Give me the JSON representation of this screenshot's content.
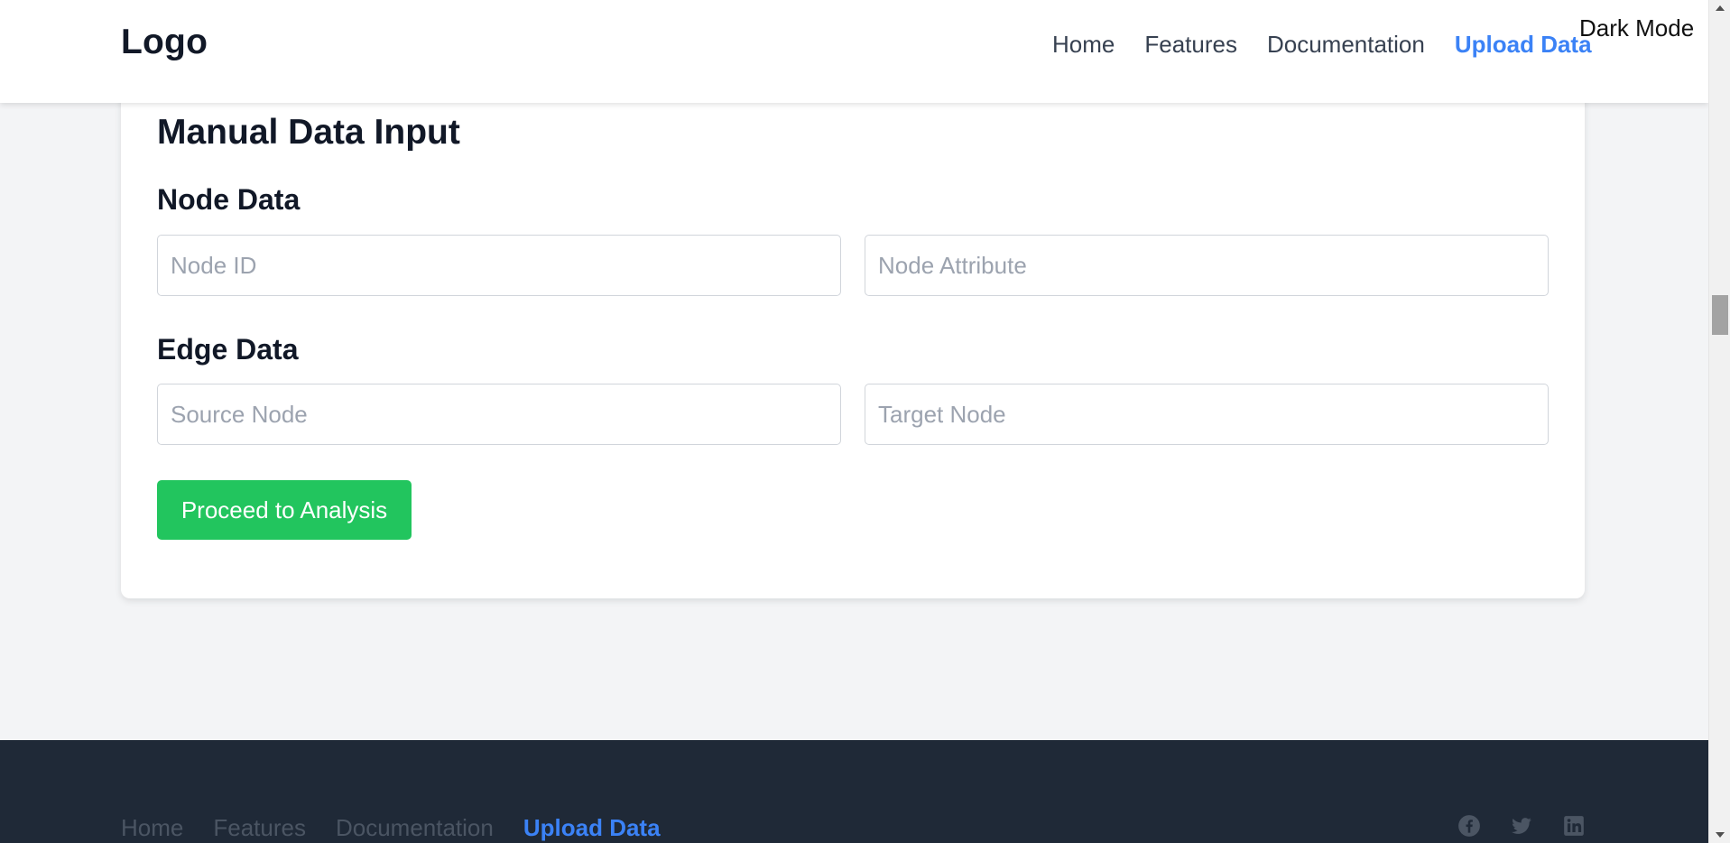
{
  "header": {
    "logo": "Logo",
    "nav": [
      "Home",
      "Features",
      "Documentation",
      "Upload Data"
    ],
    "active_nav": "Upload Data",
    "dark_mode_label": "Dark Mode"
  },
  "card": {
    "title": "Manual Data Input",
    "node_section": {
      "title": "Node Data",
      "node_id_placeholder": "Node ID",
      "node_attribute_placeholder": "Node Attribute"
    },
    "edge_section": {
      "title": "Edge Data",
      "source_placeholder": "Source Node",
      "target_placeholder": "Target Node"
    },
    "proceed_label": "Proceed to Analysis"
  },
  "footer": {
    "nav": [
      "Home",
      "Features",
      "Documentation",
      "Upload Data"
    ],
    "social_icons": [
      "facebook-icon",
      "twitter-icon",
      "linkedin-icon"
    ]
  },
  "colors": {
    "accent": "#3b82f6",
    "button": "#22c55e",
    "footer_bg": "#1f2937",
    "page_bg": "#f3f4f6"
  }
}
